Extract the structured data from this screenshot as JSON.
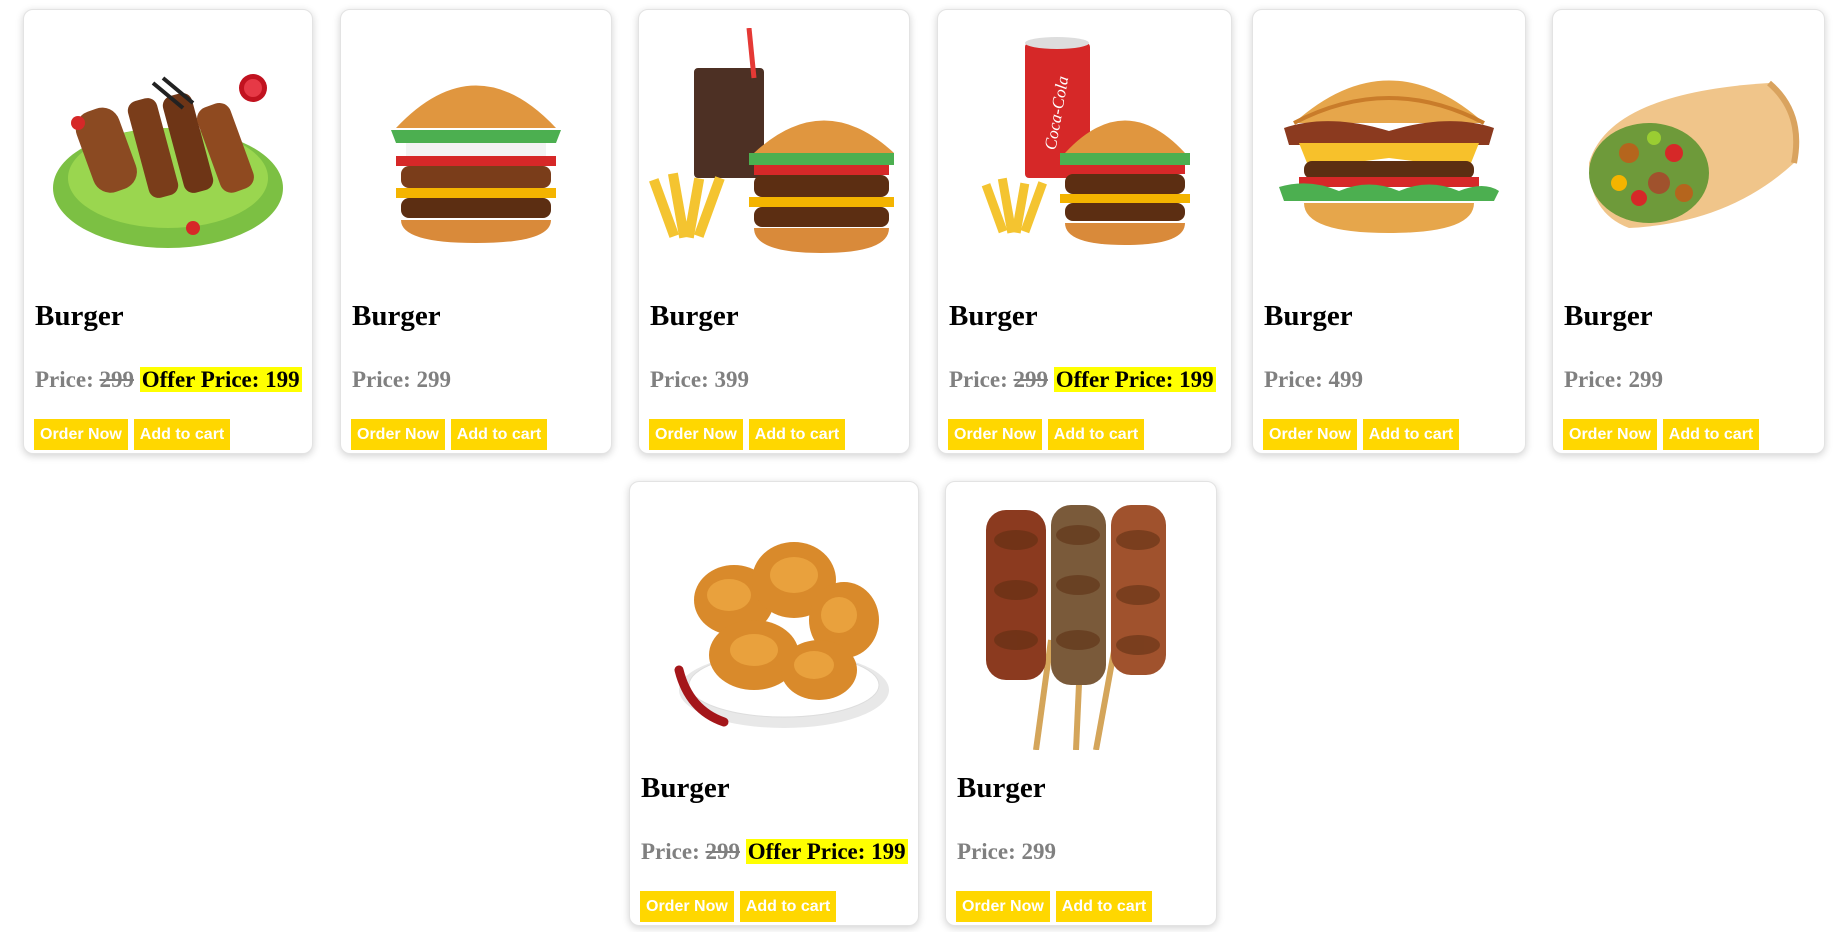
{
  "cards": [
    {
      "title": "Burger",
      "price_label": "Price:",
      "price": "299",
      "offer_label": "Offer Price:",
      "offer_price": "199",
      "order_label": "Order Now",
      "cart_label": "Add to cart",
      "image": "grilled-meat-skewers-platter"
    },
    {
      "title": "Burger",
      "price_label": "Price:",
      "price": "299",
      "order_label": "Order Now",
      "cart_label": "Add to cart",
      "image": "double-burger"
    },
    {
      "title": "Burger",
      "price_label": "Price:",
      "price": "399",
      "order_label": "Order Now",
      "cart_label": "Add to cart",
      "image": "burger-fries-cola-combo"
    },
    {
      "title": "Burger",
      "price_label": "Price:",
      "price": "299",
      "offer_label": "Offer Price:",
      "offer_price": "199",
      "order_label": "Order Now",
      "cart_label": "Add to cart",
      "image": "burger-fries-coca-cola-combo",
      "cup_text": "Coca-Cola"
    },
    {
      "title": "Burger",
      "price_label": "Price:",
      "price": "499",
      "order_label": "Order Now",
      "cart_label": "Add to cart",
      "image": "bacon-cheeseburger"
    },
    {
      "title": "Burger",
      "price_label": "Price:",
      "price": "299",
      "order_label": "Order Now",
      "cart_label": "Add to cart",
      "image": "chicken-wrap"
    },
    {
      "title": "Burger",
      "price_label": "Price:",
      "price": "299",
      "offer_label": "Offer Price:",
      "offer_price": "199",
      "order_label": "Order Now",
      "cart_label": "Add to cart",
      "image": "fried-chicken-plate"
    },
    {
      "title": "Burger",
      "price_label": "Price:",
      "price": "299",
      "order_label": "Order Now",
      "cart_label": "Add to cart",
      "image": "meat-skewers"
    }
  ],
  "colors": {
    "button_bg": "#ffd700",
    "button_text": "#ffffff",
    "offer_highlight": "#ffff00",
    "price_text": "#808080"
  }
}
